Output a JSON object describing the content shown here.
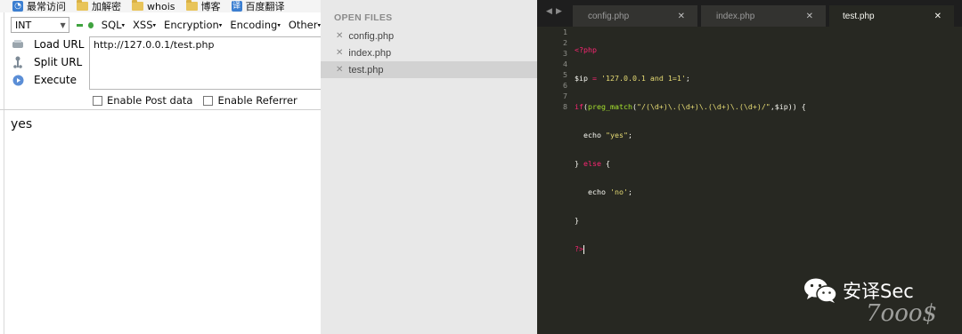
{
  "bookmarks": [
    {
      "label": "最常访问",
      "icon": "frequent-icon"
    },
    {
      "label": "加解密",
      "icon": "folder-icon"
    },
    {
      "label": "whois",
      "icon": "folder-icon"
    },
    {
      "label": "博客",
      "icon": "folder-icon"
    },
    {
      "label": "百度翻译",
      "icon": "translate-icon"
    }
  ],
  "hackbar": {
    "int_select": "INT",
    "menus": [
      "SQL",
      "XSS",
      "Encryption",
      "Encoding",
      "Other"
    ],
    "actions": [
      {
        "label": "Load URL",
        "icon": "load-url-icon"
      },
      {
        "label": "Split URL",
        "icon": "split-url-icon"
      },
      {
        "label": "Execute",
        "icon": "execute-icon"
      }
    ],
    "url": "http://127.0.0.1/test.php",
    "options": [
      "Enable Post data",
      "Enable Referrer"
    ]
  },
  "page_output": "yes",
  "sidebar": {
    "header": "OPEN FILES",
    "files": [
      "config.php",
      "index.php",
      "test.php"
    ],
    "active_file": "test.php"
  },
  "editor": {
    "tabs": [
      "config.php",
      "index.php",
      "test.php"
    ],
    "active_tab": "test.php",
    "line_numbers": [
      "1",
      "2",
      "3",
      "4",
      "5",
      "6",
      "7",
      "8"
    ]
  },
  "watermark": {
    "text": "安译Sec",
    "sub": "7ooo$"
  },
  "colors": {
    "editor_bg": "#272822",
    "keyword": "#f92672",
    "function": "#a6e22e",
    "string": "#e6db74",
    "sidebar_bg": "#e8e8e8"
  }
}
